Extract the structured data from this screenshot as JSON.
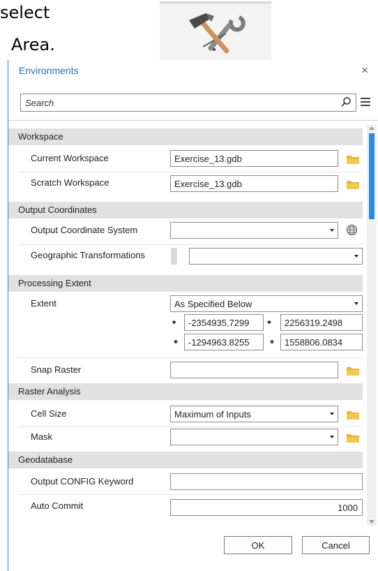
{
  "background": {
    "text_line1": "select",
    "text_line2": "Area.",
    "tool_icon": "hammer-wrench-icon"
  },
  "dialog": {
    "title": "Environments",
    "close_label": "×",
    "search": {
      "placeholder": "Search"
    },
    "sections": {
      "workspace": {
        "title": "Workspace",
        "current_workspace": {
          "label": "Current Workspace",
          "value": "Exercise_13.gdb"
        },
        "scratch_workspace": {
          "label": "Scratch Workspace",
          "value": "Exercise_13.gdb"
        }
      },
      "output_coordinates": {
        "title": "Output Coordinates",
        "output_coordinate_system": {
          "label": "Output Coordinate System",
          "value": ""
        },
        "geographic_transformations": {
          "label": "Geographic Transformations",
          "value": ""
        }
      },
      "processing_extent": {
        "title": "Processing Extent",
        "extent": {
          "label": "Extent",
          "value": "As Specified Below",
          "left": "-2354935.7299",
          "right": "2256319.2498",
          "bottom": "-1294963.8255",
          "top": "1558806.0834"
        },
        "snap_raster": {
          "label": "Snap Raster",
          "value": ""
        }
      },
      "raster_analysis": {
        "title": "Raster Analysis",
        "cell_size": {
          "label": "Cell Size",
          "value": "Maximum of Inputs"
        },
        "mask": {
          "label": "Mask",
          "value": ""
        }
      },
      "geodatabase": {
        "title": "Geodatabase",
        "output_config_keyword": {
          "label": "Output CONFIG Keyword",
          "value": ""
        },
        "auto_commit": {
          "label": "Auto Commit",
          "value": "1000"
        }
      }
    },
    "buttons": {
      "ok": "OK",
      "cancel": "Cancel"
    },
    "colors": {
      "accent": "#2b79d6",
      "title": "#2b6fb8",
      "section_bg": "#e1e1e1",
      "folder": "#e8b33a",
      "scroll_thumb": "#2a8de0"
    }
  }
}
